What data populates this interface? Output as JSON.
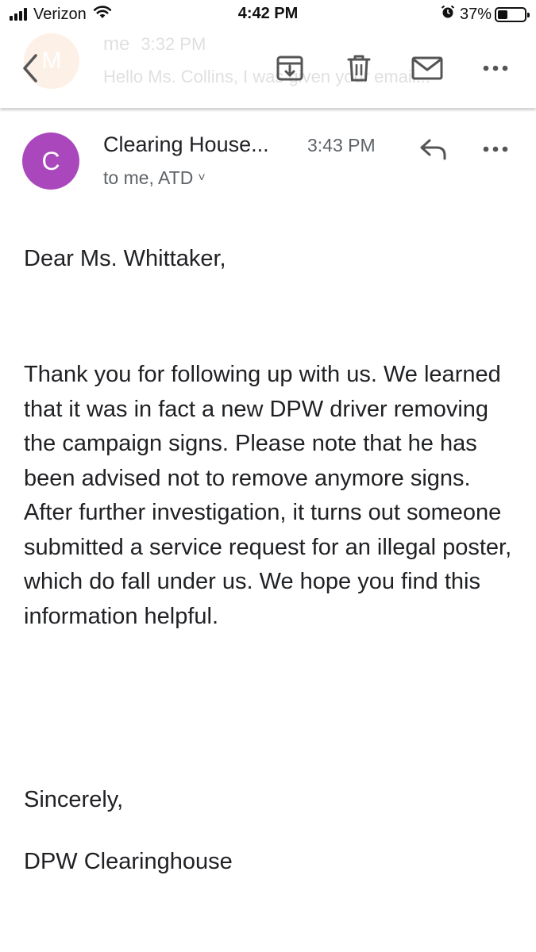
{
  "status_bar": {
    "carrier": "Verizon",
    "time": "4:42 PM",
    "battery_percent": "37%",
    "battery_level": 0.37,
    "icons": [
      "signal-icon",
      "wifi-icon",
      "alarm-icon",
      "battery-icon"
    ]
  },
  "toolbar": {
    "icons": [
      "back-icon",
      "archive-icon",
      "delete-icon",
      "mark-unread-icon",
      "more-icon"
    ],
    "previous_message": {
      "avatar_letter": "M",
      "sender": "me",
      "time": "3:32 PM",
      "snippet": "Hello Ms. Collins, I was given your email..."
    }
  },
  "message": {
    "avatar_letter": "C",
    "avatar_color": "#ab47bc",
    "sender": "Clearing House...",
    "time": "3:43 PM",
    "recipients": "to me, ATD",
    "recipients_chevron": "˅",
    "greeting": "Dear Ms. Whittaker,",
    "body": "Thank you for following up with us. We learned that it was in fact a new DPW driver removing the campaign signs. Please note that he has been advised not to remove anymore signs. After further investigation, it turns out someone submitted a service request for an illegal poster, which do fall under us. We hope you find this information helpful.",
    "signoff": "Sincerely,",
    "signature": "DPW Clearinghouse"
  }
}
